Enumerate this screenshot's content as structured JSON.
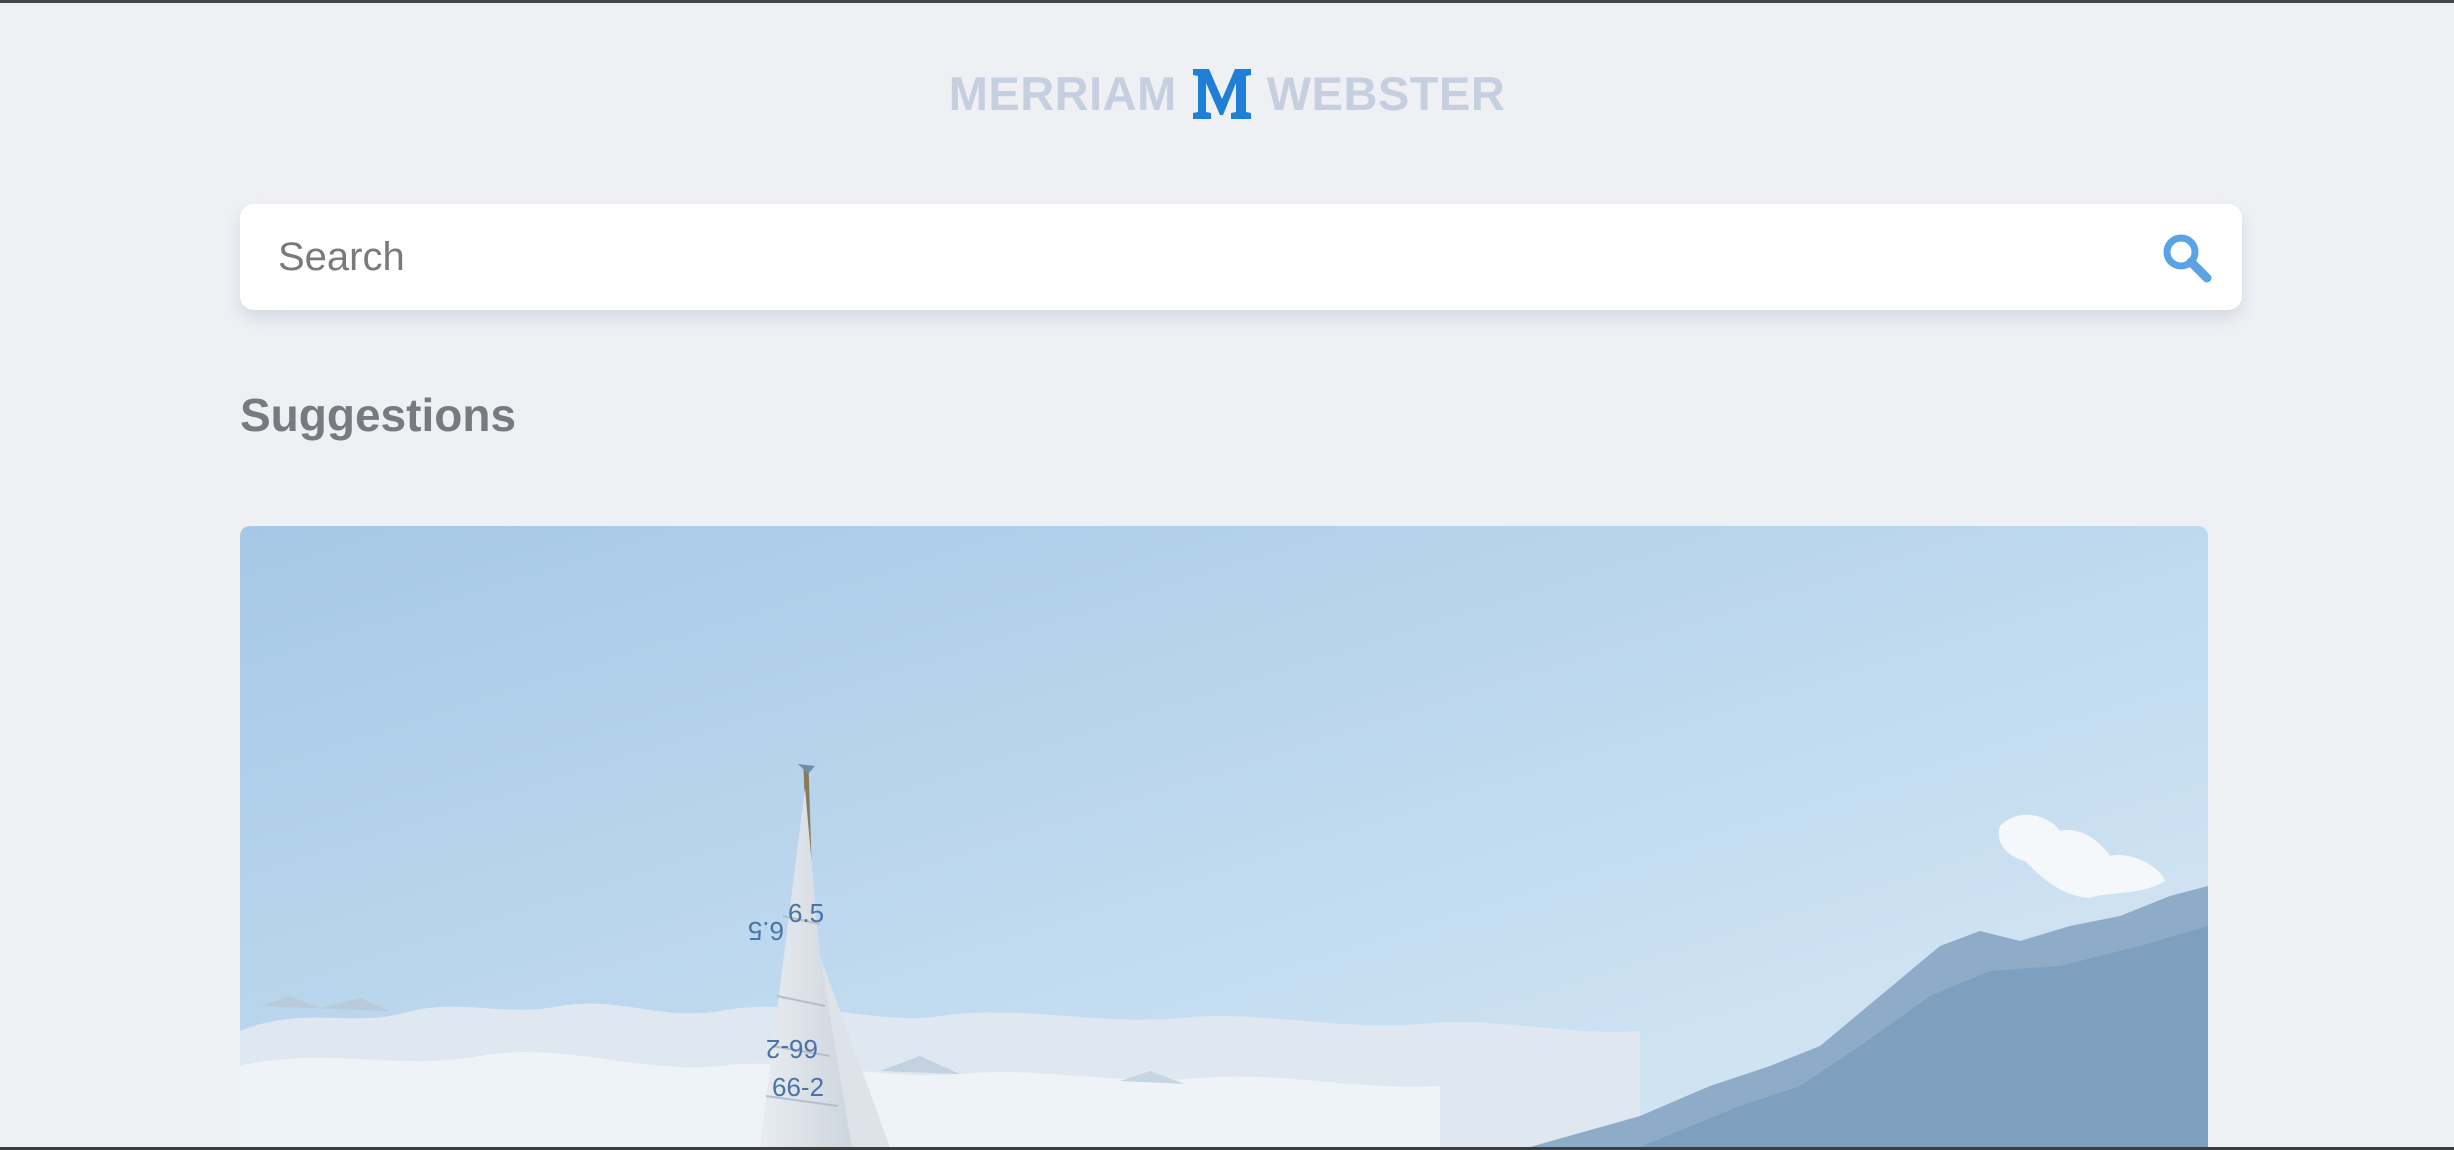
{
  "logo": {
    "left_text": "MERRIAM",
    "right_text": "WEBSTER",
    "mark_icon": "merriam-webster-m-logo"
  },
  "search": {
    "placeholder": "Search",
    "value": "",
    "icon": "search-icon"
  },
  "suggestions": {
    "title": "Suggestions",
    "cards": [
      {
        "image": "sailboat-mountains-photo",
        "sail_markings": [
          "6.5",
          "6.5",
          "66-2",
          "66-2"
        ]
      }
    ]
  },
  "colors": {
    "background": "#eef0f4",
    "logo_text": "#c5cfdf",
    "logo_mark": "#1f7fd6",
    "search_icon": "#5aa4e6",
    "heading": "#777a7f"
  }
}
